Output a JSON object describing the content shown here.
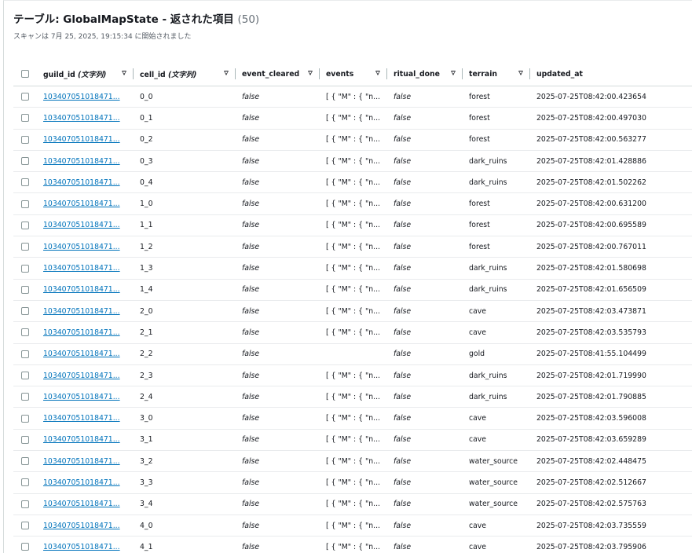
{
  "header": {
    "title": "テーブル: GlobalMapState - 返された項目",
    "count": "(50)",
    "scan_info": "スキャンは 7月 25, 2025, 19:15:34 に開始されました"
  },
  "columns": [
    {
      "key": "guild_id",
      "label": "guild_id",
      "type": "(文字列)",
      "sortable": true
    },
    {
      "key": "cell_id",
      "label": "cell_id",
      "type": "(文字列)",
      "sortable": true
    },
    {
      "key": "event_cleared",
      "label": "event_cleared",
      "type": "",
      "sortable": true
    },
    {
      "key": "events",
      "label": "events",
      "type": "",
      "sortable": true
    },
    {
      "key": "ritual_done",
      "label": "ritual_done",
      "type": "",
      "sortable": true
    },
    {
      "key": "terrain",
      "label": "terrain",
      "type": "",
      "sortable": true
    },
    {
      "key": "updated_at",
      "label": "updated_at",
      "type": "",
      "sortable": false
    }
  ],
  "rows": [
    {
      "guild_id": "103407051018471...",
      "cell_id": "0_0",
      "event_cleared": "false",
      "events": "[ { \"M\" : { \"n...",
      "ritual_done": "false",
      "terrain": "forest",
      "updated_at": "2025-07-25T08:42:00.423654"
    },
    {
      "guild_id": "103407051018471...",
      "cell_id": "0_1",
      "event_cleared": "false",
      "events": "[ { \"M\" : { \"n...",
      "ritual_done": "false",
      "terrain": "forest",
      "updated_at": "2025-07-25T08:42:00.497030"
    },
    {
      "guild_id": "103407051018471...",
      "cell_id": "0_2",
      "event_cleared": "false",
      "events": "[ { \"M\" : { \"n...",
      "ritual_done": "false",
      "terrain": "forest",
      "updated_at": "2025-07-25T08:42:00.563277"
    },
    {
      "guild_id": "103407051018471...",
      "cell_id": "0_3",
      "event_cleared": "false",
      "events": "[ { \"M\" : { \"n...",
      "ritual_done": "false",
      "terrain": "dark_ruins",
      "updated_at": "2025-07-25T08:42:01.428886"
    },
    {
      "guild_id": "103407051018471...",
      "cell_id": "0_4",
      "event_cleared": "false",
      "events": "[ { \"M\" : { \"n...",
      "ritual_done": "false",
      "terrain": "dark_ruins",
      "updated_at": "2025-07-25T08:42:01.502262"
    },
    {
      "guild_id": "103407051018471...",
      "cell_id": "1_0",
      "event_cleared": "false",
      "events": "[ { \"M\" : { \"n...",
      "ritual_done": "false",
      "terrain": "forest",
      "updated_at": "2025-07-25T08:42:00.631200"
    },
    {
      "guild_id": "103407051018471...",
      "cell_id": "1_1",
      "event_cleared": "false",
      "events": "[ { \"M\" : { \"n...",
      "ritual_done": "false",
      "terrain": "forest",
      "updated_at": "2025-07-25T08:42:00.695589"
    },
    {
      "guild_id": "103407051018471...",
      "cell_id": "1_2",
      "event_cleared": "false",
      "events": "[ { \"M\" : { \"n...",
      "ritual_done": "false",
      "terrain": "forest",
      "updated_at": "2025-07-25T08:42:00.767011"
    },
    {
      "guild_id": "103407051018471...",
      "cell_id": "1_3",
      "event_cleared": "false",
      "events": "[ { \"M\" : { \"n...",
      "ritual_done": "false",
      "terrain": "dark_ruins",
      "updated_at": "2025-07-25T08:42:01.580698"
    },
    {
      "guild_id": "103407051018471...",
      "cell_id": "1_4",
      "event_cleared": "false",
      "events": "[ { \"M\" : { \"n...",
      "ritual_done": "false",
      "terrain": "dark_ruins",
      "updated_at": "2025-07-25T08:42:01.656509"
    },
    {
      "guild_id": "103407051018471...",
      "cell_id": "2_0",
      "event_cleared": "false",
      "events": "[ { \"M\" : { \"n...",
      "ritual_done": "false",
      "terrain": "cave",
      "updated_at": "2025-07-25T08:42:03.473871"
    },
    {
      "guild_id": "103407051018471...",
      "cell_id": "2_1",
      "event_cleared": "false",
      "events": "[ { \"M\" : { \"n...",
      "ritual_done": "false",
      "terrain": "cave",
      "updated_at": "2025-07-25T08:42:03.535793"
    },
    {
      "guild_id": "103407051018471...",
      "cell_id": "2_2",
      "event_cleared": "false",
      "events": "",
      "ritual_done": "false",
      "terrain": "gold",
      "updated_at": "2025-07-25T08:41:55.104499"
    },
    {
      "guild_id": "103407051018471...",
      "cell_id": "2_3",
      "event_cleared": "false",
      "events": "[ { \"M\" : { \"n...",
      "ritual_done": "false",
      "terrain": "dark_ruins",
      "updated_at": "2025-07-25T08:42:01.719990"
    },
    {
      "guild_id": "103407051018471...",
      "cell_id": "2_4",
      "event_cleared": "false",
      "events": "[ { \"M\" : { \"n...",
      "ritual_done": "false",
      "terrain": "dark_ruins",
      "updated_at": "2025-07-25T08:42:01.790885"
    },
    {
      "guild_id": "103407051018471...",
      "cell_id": "3_0",
      "event_cleared": "false",
      "events": "[ { \"M\" : { \"n...",
      "ritual_done": "false",
      "terrain": "cave",
      "updated_at": "2025-07-25T08:42:03.596008"
    },
    {
      "guild_id": "103407051018471...",
      "cell_id": "3_1",
      "event_cleared": "false",
      "events": "[ { \"M\" : { \"n...",
      "ritual_done": "false",
      "terrain": "cave",
      "updated_at": "2025-07-25T08:42:03.659289"
    },
    {
      "guild_id": "103407051018471...",
      "cell_id": "3_2",
      "event_cleared": "false",
      "events": "[ { \"M\" : { \"n...",
      "ritual_done": "false",
      "terrain": "water_source",
      "updated_at": "2025-07-25T08:42:02.448475"
    },
    {
      "guild_id": "103407051018471...",
      "cell_id": "3_3",
      "event_cleared": "false",
      "events": "[ { \"M\" : { \"n...",
      "ritual_done": "false",
      "terrain": "water_source",
      "updated_at": "2025-07-25T08:42:02.512667"
    },
    {
      "guild_id": "103407051018471...",
      "cell_id": "3_4",
      "event_cleared": "false",
      "events": "[ { \"M\" : { \"n...",
      "ritual_done": "false",
      "terrain": "water_source",
      "updated_at": "2025-07-25T08:42:02.575763"
    },
    {
      "guild_id": "103407051018471...",
      "cell_id": "4_0",
      "event_cleared": "false",
      "events": "[ { \"M\" : { \"n...",
      "ritual_done": "false",
      "terrain": "cave",
      "updated_at": "2025-07-25T08:42:03.735559"
    },
    {
      "guild_id": "103407051018471...",
      "cell_id": "4_1",
      "event_cleared": "false",
      "events": "[ { \"M\" : { \"n...",
      "ritual_done": "false",
      "terrain": "cave",
      "updated_at": "2025-07-25T08:42:03.795906"
    }
  ],
  "colors": {
    "link": "#0073bb",
    "text": "#16191f",
    "muted": "#687078",
    "border": "#e9ebed"
  },
  "icons": {
    "sort": "caret-down-icon",
    "select": "checkbox"
  }
}
